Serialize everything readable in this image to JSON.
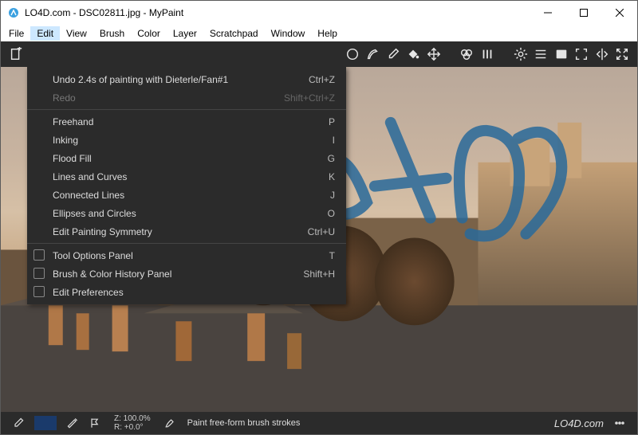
{
  "window": {
    "title": "LO4D.com - DSC02811.jpg - MyPaint"
  },
  "menubar": {
    "items": [
      "File",
      "Edit",
      "View",
      "Brush",
      "Color",
      "Layer",
      "Scratchpad",
      "Window",
      "Help"
    ],
    "active_index": 1
  },
  "edit_menu": {
    "undo": {
      "label": "Undo 2.4s of painting with Dieterle/Fan#1",
      "shortcut": "Ctrl+Z"
    },
    "redo": {
      "label": "Redo",
      "shortcut": "Shift+Ctrl+Z"
    },
    "tools": [
      {
        "label": "Freehand",
        "shortcut": "P"
      },
      {
        "label": "Inking",
        "shortcut": "I"
      },
      {
        "label": "Flood Fill",
        "shortcut": "G"
      },
      {
        "label": "Lines and Curves",
        "shortcut": "K"
      },
      {
        "label": "Connected Lines",
        "shortcut": "J"
      },
      {
        "label": "Ellipses and Circles",
        "shortcut": "O"
      },
      {
        "label": "Edit Painting Symmetry",
        "shortcut": "Ctrl+U"
      }
    ],
    "panels": [
      {
        "label": "Tool Options Panel",
        "shortcut": "T"
      },
      {
        "label": "Brush & Color History Panel",
        "shortcut": "Shift+H"
      },
      {
        "label": "Edit Preferences",
        "shortcut": ""
      }
    ]
  },
  "toolbar_icons": [
    "new-doc",
    "open",
    "save",
    "undo",
    "redo",
    "ellipse-tool",
    "pen-tool",
    "eyedropper",
    "bucket",
    "move",
    "color-rings",
    "brushes",
    "gear",
    "lines",
    "card",
    "fullscreen",
    "symmetry",
    "expand"
  ],
  "statusbar": {
    "zoom_line1": "Z: 100.0%",
    "zoom_line2": "R: +0.0°",
    "hint": "Paint free-form brush strokes"
  },
  "watermark": "LO4D.com",
  "colors": {
    "swatch": "#1a4a7b"
  }
}
